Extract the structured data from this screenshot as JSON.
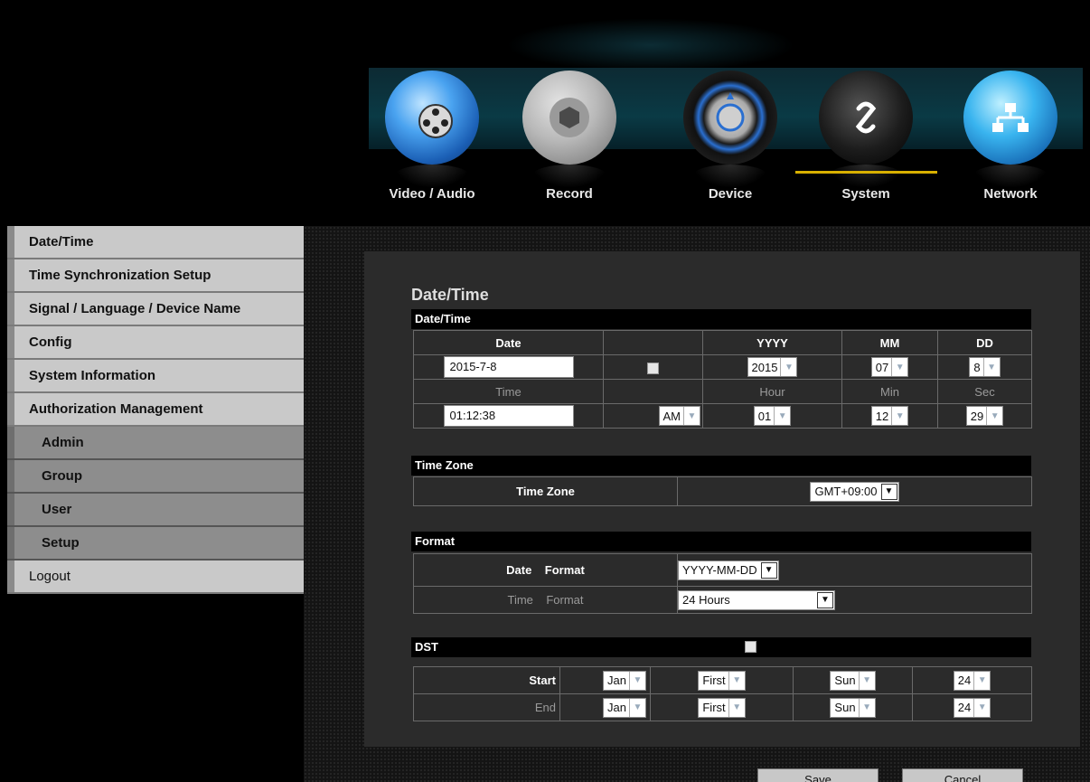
{
  "nav": {
    "items": [
      {
        "label": "Video / Audio",
        "icon": "video-audio-icon"
      },
      {
        "label": "Record",
        "icon": "record-icon"
      },
      {
        "label": "Device",
        "icon": "device-icon"
      },
      {
        "label": "System",
        "icon": "system-icon"
      },
      {
        "label": "Network",
        "icon": "network-icon"
      }
    ],
    "active": "System",
    "accent_color": "#d8b000"
  },
  "sidebar": {
    "items": [
      {
        "label": "Date/Time"
      },
      {
        "label": "Time Synchronization Setup"
      },
      {
        "label": "Signal / Language / Device Name"
      },
      {
        "label": "Config"
      },
      {
        "label": "System Information"
      },
      {
        "label": "Authorization Management"
      }
    ],
    "sub_items": [
      {
        "label": "Admin"
      },
      {
        "label": "Group"
      },
      {
        "label": "User"
      },
      {
        "label": "Setup"
      }
    ],
    "logout": "Logout"
  },
  "main": {
    "title": "Date/Time",
    "datetime": {
      "section": "Date/Time",
      "headers": {
        "date": "Date",
        "yyyy": "YYYY",
        "mm": "MM",
        "dd": "DD"
      },
      "date_value": "2015-7-8",
      "year": "2015",
      "month": "07",
      "day": "8",
      "sub_headers": {
        "time": "Time",
        "hour": "Hour",
        "min": "Min",
        "sec": "Sec"
      },
      "time_value": "01:12:38",
      "ampm": "AM",
      "hour": "01",
      "minute": "12",
      "second": "29"
    },
    "timezone": {
      "section": "Time Zone",
      "label": "Time Zone",
      "value": "GMT+09:00"
    },
    "format": {
      "section": "Format",
      "date_label_1": "Date",
      "date_label_2": "Format",
      "date_value": "YYYY-MM-DD",
      "time_label_1": "Time",
      "time_label_2": "Format",
      "time_value": "24 Hours"
    },
    "dst": {
      "section": "DST",
      "start_label": "Start",
      "end_label": "End",
      "start": {
        "month": "Jan",
        "week": "First",
        "day": "Sun",
        "hour": "24"
      },
      "end": {
        "month": "Jan",
        "week": "First",
        "day": "Sun",
        "hour": "24"
      }
    }
  },
  "buttons": {
    "save": "Save",
    "cancel": "Cancel"
  }
}
